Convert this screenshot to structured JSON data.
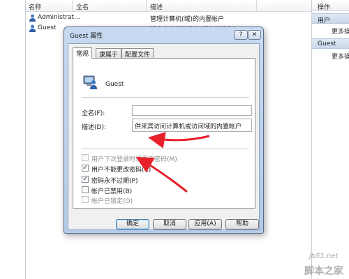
{
  "list": {
    "columns": [
      "名称",
      "全名",
      "描述"
    ],
    "rows": [
      {
        "name": "Administrat...",
        "full_name": "",
        "description": "管理计算机(域)的内置帐户"
      },
      {
        "name": "Guest",
        "full_name": "",
        "description": "供来宾访问计算机或访问域的内"
      }
    ]
  },
  "actions": {
    "header": "操作",
    "sections": [
      {
        "title": "用户",
        "more": "更多操..."
      },
      {
        "title": "Guest",
        "more": "更多操..."
      }
    ]
  },
  "dialog": {
    "title": "Guest 属性",
    "help_glyph": "?",
    "close_glyph": "✕",
    "tabs": [
      "常规",
      "隶属于",
      "配置文件"
    ],
    "user_name": "Guest",
    "fullname_label": "全名(F):",
    "fullname_value": "",
    "desc_label": "描述(D):",
    "desc_value": "供来宾访问计算机或访问域的内置帐户",
    "checkboxes": [
      {
        "label": "用户下次登录时须更改密码(M)",
        "checked": false,
        "disabled": true
      },
      {
        "label": "用户不能更改密码(C)",
        "checked": true,
        "disabled": false
      },
      {
        "label": "密码永不过期(P)",
        "checked": true,
        "disabled": false
      },
      {
        "label": "帐户已禁用(B)",
        "checked": false,
        "disabled": false
      },
      {
        "label": "帐户已锁定(O)",
        "checked": false,
        "disabled": true
      }
    ],
    "buttons": {
      "ok": "确定",
      "cancel": "取消",
      "apply": "应用(A)",
      "help": "帮助"
    }
  },
  "check_glyph": "✓",
  "annotation_color": "#e8202a",
  "watermark": {
    "site": "jb51.net",
    "name": "脚本之家"
  }
}
